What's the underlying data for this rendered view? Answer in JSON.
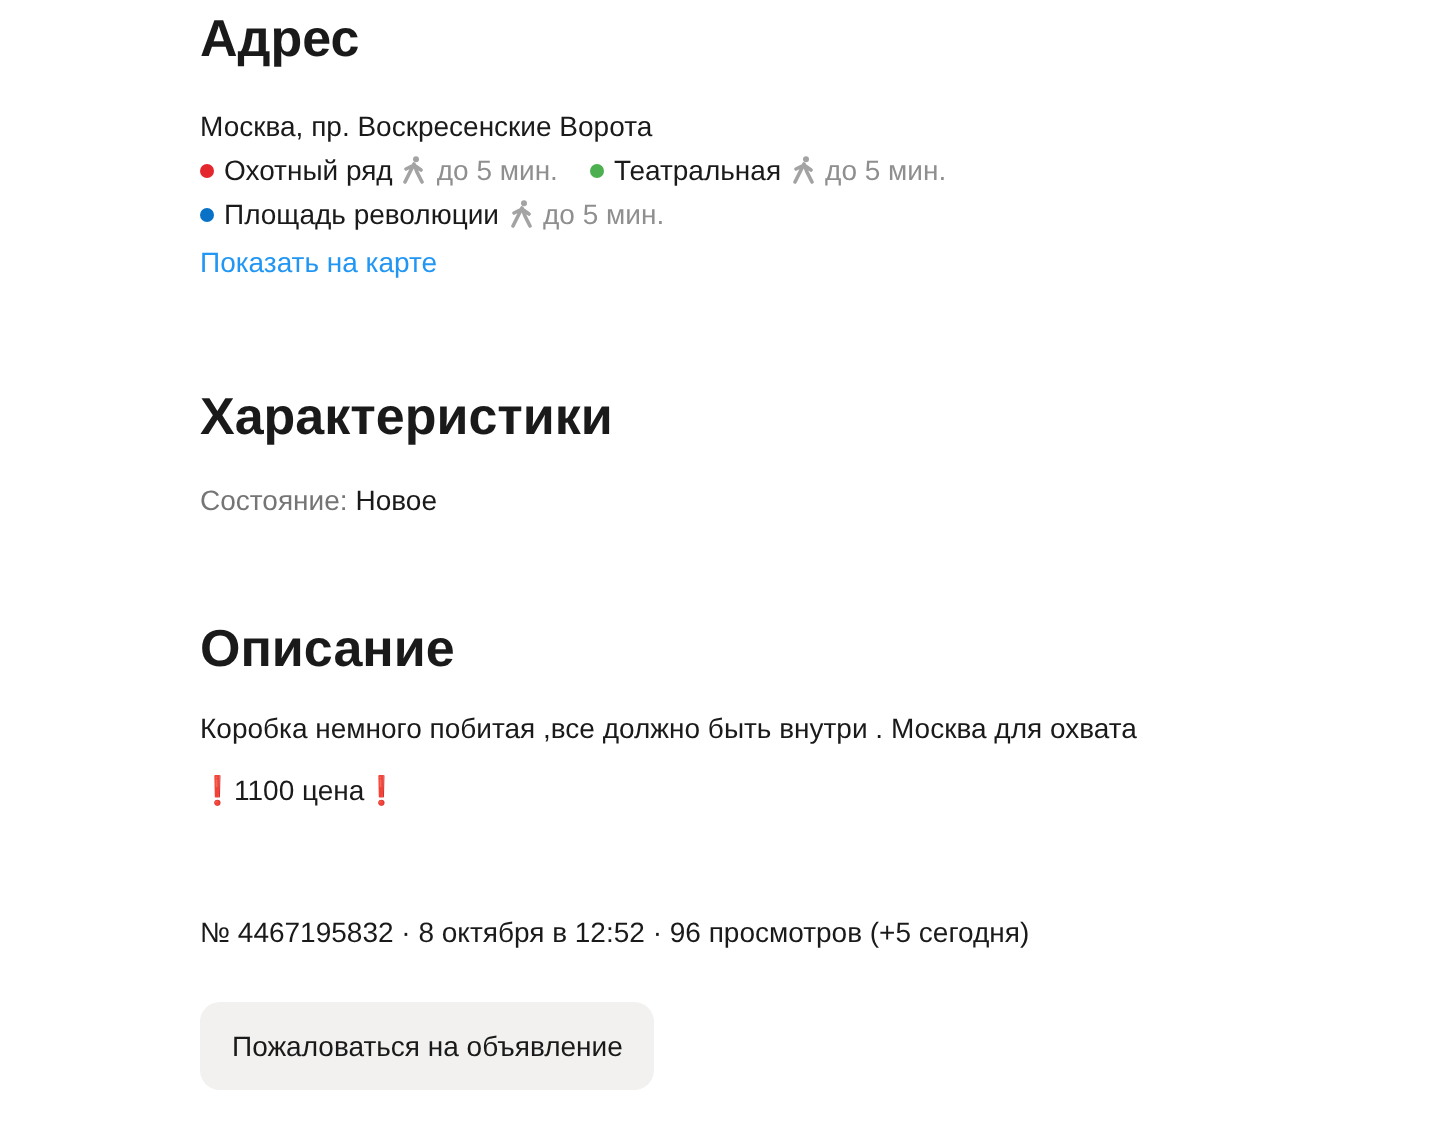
{
  "address": {
    "heading": "Адрес",
    "street": "Москва, пр. Воскресенские Ворота",
    "metro": [
      {
        "name": "Охотный ряд",
        "color": "#e4262d",
        "time": "до 5 мин."
      },
      {
        "name": "Театральная",
        "color": "#4caf50",
        "time": "до 5 мин."
      },
      {
        "name": "Площадь революции",
        "color": "#0a72c6",
        "time": "до 5 мин."
      }
    ],
    "map_link": "Показать на карте"
  },
  "characteristics": {
    "heading": "Характеристики",
    "items": [
      {
        "label": "Состояние:",
        "value": "Новое"
      }
    ]
  },
  "description": {
    "heading": "Описание",
    "paragraphs": [
      "Коробка немного побитая ,все должно быть внутри . Москва для охвата",
      "❗1100 цена❗"
    ]
  },
  "meta": "№ 4467195832 · 8 октября в 12:52 · 96 просмотров (+5 сегодня)",
  "report_button": "Пожаловаться на объявление"
}
